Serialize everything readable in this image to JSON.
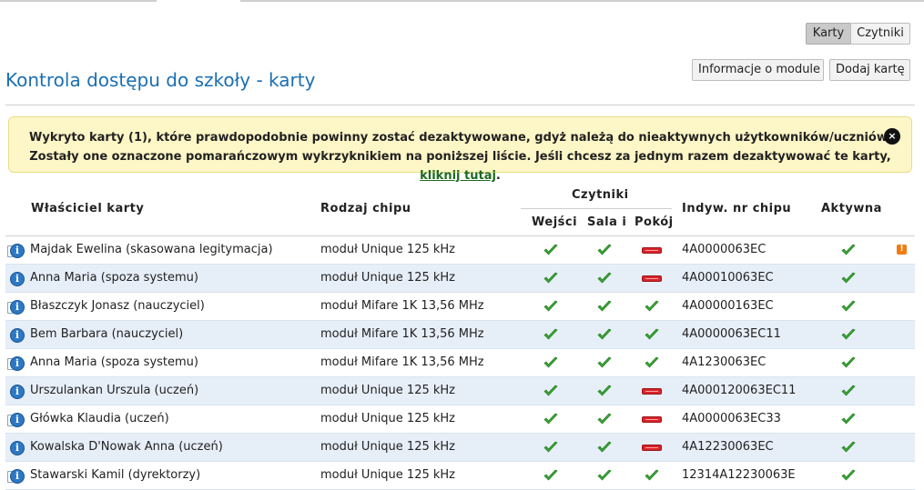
{
  "toolbar": {
    "tab_cards": "Karty",
    "tab_readers": "Czytniki",
    "module_info": "Informacje o module",
    "add_card": "Dodaj kartę"
  },
  "page": {
    "title": "Kontrola dostępu do szkoły - karty"
  },
  "alert": {
    "line1": "Wykryto karty (1), które prawdopodobnie powinny zostać dezaktywowane, gdyż należą do nieaktywnych użytkowników/uczniów.",
    "line2_before": "Zostały one oznaczone pomarańczowym wykrzyknikiem na poniższej liście. Jeśli chcesz za jednym razem dezaktywować te karty, ",
    "link": "kliknij tutaj",
    "line2_after": ".",
    "close_icon": "×"
  },
  "table": {
    "headers": {
      "owner": "Właściciel karty",
      "chip_type": "Rodzaj chipu",
      "readers_group": "Czytniki",
      "reader1": "Wejści",
      "reader2": "Sala i",
      "reader3": "Pokój",
      "chip_no": "Indyw. nr chipu",
      "active": "Aktywna"
    },
    "rows": [
      {
        "owner": "Majdak Ewelina (skasowana legitymacja)",
        "chip": "moduł Unique 125 kHz",
        "r1": true,
        "r2": true,
        "r3": false,
        "chip_no": "4A0000063EC",
        "active": true,
        "warn": true
      },
      {
        "owner": "Anna Maria (spoza systemu)",
        "chip": "moduł Unique 125 kHz",
        "r1": true,
        "r2": true,
        "r3": false,
        "chip_no": "4A00010063EC",
        "active": true,
        "warn": false
      },
      {
        "owner": "Błaszczyk Jonasz (nauczyciel)",
        "chip": "moduł Mifare 1K 13,56 MHz",
        "r1": true,
        "r2": true,
        "r3": true,
        "chip_no": "4A00000163EC",
        "active": true,
        "warn": false
      },
      {
        "owner": "Bem Barbara (nauczyciel)",
        "chip": "moduł Mifare 1K 13,56 MHz",
        "r1": true,
        "r2": true,
        "r3": true,
        "chip_no": "4A0000063EC11",
        "active": true,
        "warn": false
      },
      {
        "owner": "Anna Maria (spoza systemu)",
        "chip": "moduł Mifare 1K 13,56 MHz",
        "r1": true,
        "r2": true,
        "r3": true,
        "chip_no": "4A1230063EC",
        "active": true,
        "warn": false
      },
      {
        "owner": "Urszulankan Urszula (uczeń)",
        "chip": "moduł Unique 125 kHz",
        "r1": true,
        "r2": true,
        "r3": false,
        "chip_no": "4A000120063EC11",
        "active": true,
        "warn": false
      },
      {
        "owner": "Główka Klaudia (uczeń)",
        "chip": "moduł Unique 125 kHz",
        "r1": true,
        "r2": true,
        "r3": false,
        "chip_no": "4A0000063EC33",
        "active": true,
        "warn": false
      },
      {
        "owner": "Kowalska D'Nowak Anna (uczeń)",
        "chip": "moduł Unique 125 kHz",
        "r1": true,
        "r2": true,
        "r3": false,
        "chip_no": "4A12230063EC",
        "active": true,
        "warn": false
      },
      {
        "owner": "Stawarski Kamil (dyrektorzy)",
        "chip": "moduł Unique 125 kHz",
        "r1": true,
        "r2": true,
        "r3": true,
        "chip_no": "12314A12230063E",
        "active": true,
        "warn": false
      }
    ]
  },
  "colors": {
    "accent": "#1a6fb3",
    "alert_bg": "#fdf6c6",
    "check": "#3aa935",
    "disabled": "#d9232a",
    "warn": "#ef7d14",
    "row_alt": "#e6eef8"
  },
  "icons": {
    "info": "info-icon",
    "check": "check-icon",
    "disabled": "disabled-bar-icon",
    "warning": "warning-icon",
    "warning_glyph": "!",
    "info_glyph": "i"
  }
}
